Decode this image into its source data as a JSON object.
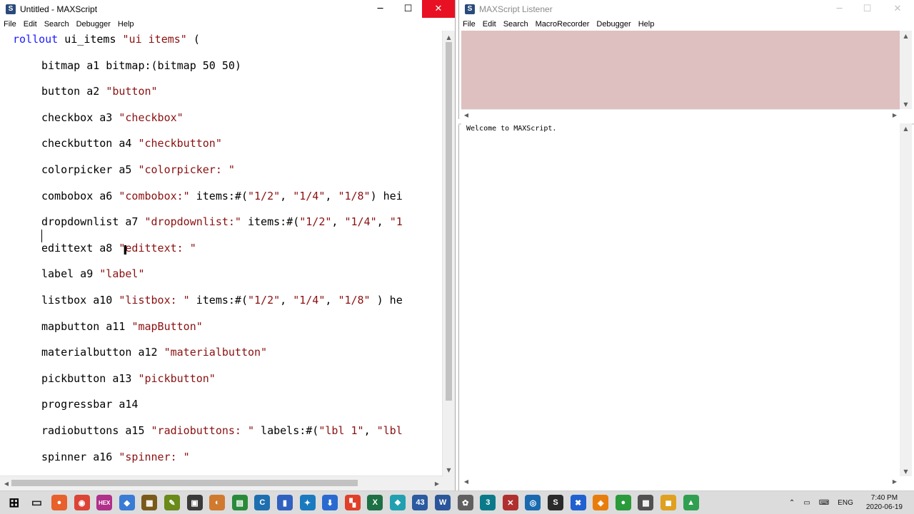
{
  "editor": {
    "title": "Untitled - MAXScript",
    "menu": [
      "File",
      "Edit",
      "Search",
      "Debugger",
      "Help"
    ],
    "code_lines": [
      {
        "indent": 0,
        "parts": [
          [
            "kw",
            "rollout"
          ],
          [
            "t",
            " ui_items "
          ],
          [
            "str",
            "\"ui items\""
          ],
          [
            "t",
            " ("
          ]
        ]
      },
      {
        "indent": 1,
        "parts": [
          [
            "t",
            "bitmap a1 bitmap:(bitmap 50 50)"
          ]
        ]
      },
      {
        "indent": 1,
        "parts": [
          [
            "t",
            "button a2 "
          ],
          [
            "str",
            "\"button\""
          ]
        ]
      },
      {
        "indent": 1,
        "parts": [
          [
            "t",
            "checkbox a3 "
          ],
          [
            "str",
            "\"checkbox\""
          ]
        ]
      },
      {
        "indent": 1,
        "parts": [
          [
            "t",
            "checkbutton a4 "
          ],
          [
            "str",
            "\"checkbutton\""
          ]
        ]
      },
      {
        "indent": 1,
        "parts": [
          [
            "t",
            "colorpicker a5 "
          ],
          [
            "str",
            "\"colorpicker: \""
          ]
        ]
      },
      {
        "indent": 1,
        "parts": [
          [
            "t",
            "combobox a6 "
          ],
          [
            "str",
            "\"combobox:\""
          ],
          [
            "t",
            " items:#("
          ],
          [
            "str",
            "\"1/2\""
          ],
          [
            "t",
            ", "
          ],
          [
            "str",
            "\"1/4\""
          ],
          [
            "t",
            ", "
          ],
          [
            "str",
            "\"1/8\""
          ],
          [
            "t",
            ") hei"
          ]
        ]
      },
      {
        "indent": 1,
        "parts": [
          [
            "t",
            "dropdownlist a7 "
          ],
          [
            "str",
            "\"dropdownlist:\""
          ],
          [
            "t",
            " items:#("
          ],
          [
            "str",
            "\"1/2\""
          ],
          [
            "t",
            ", "
          ],
          [
            "str",
            "\"1/4\""
          ],
          [
            "t",
            ", "
          ],
          [
            "str",
            "\"1"
          ]
        ]
      },
      {
        "indent": 1,
        "parts": [
          [
            "t",
            "edittext a8 "
          ],
          [
            "str",
            "\"edittext: \""
          ]
        ]
      },
      {
        "indent": 1,
        "parts": [
          [
            "t",
            "label a9 "
          ],
          [
            "str",
            "\"label\""
          ]
        ]
      },
      {
        "indent": 1,
        "parts": [
          [
            "t",
            "listbox a10 "
          ],
          [
            "str",
            "\"listbox: \""
          ],
          [
            "t",
            " items:#("
          ],
          [
            "str",
            "\"1/2\""
          ],
          [
            "t",
            ", "
          ],
          [
            "str",
            "\"1/4\""
          ],
          [
            "t",
            ", "
          ],
          [
            "str",
            "\"1/8\""
          ],
          [
            "t",
            " ) he"
          ]
        ]
      },
      {
        "indent": 1,
        "parts": [
          [
            "t",
            "mapbutton a11 "
          ],
          [
            "str",
            "\"mapButton\""
          ]
        ]
      },
      {
        "indent": 1,
        "parts": [
          [
            "t",
            "materialbutton a12 "
          ],
          [
            "str",
            "\"materialbutton\""
          ]
        ]
      },
      {
        "indent": 1,
        "parts": [
          [
            "t",
            "pickbutton a13 "
          ],
          [
            "str",
            "\"pickbutton\""
          ]
        ]
      },
      {
        "indent": 1,
        "parts": [
          [
            "t",
            "progressbar a14"
          ]
        ]
      },
      {
        "indent": 1,
        "parts": [
          [
            "t",
            "radiobuttons a15 "
          ],
          [
            "str",
            "\"radiobuttons: \""
          ],
          [
            "t",
            " labels:#("
          ],
          [
            "str",
            "\"lbl 1\""
          ],
          [
            "t",
            ", "
          ],
          [
            "str",
            "\"lbl"
          ]
        ]
      },
      {
        "indent": 1,
        "parts": [
          [
            "t",
            "spinner a16 "
          ],
          [
            "str",
            "\"spinner: \""
          ]
        ]
      }
    ]
  },
  "listener": {
    "title": "MAXScript Listener",
    "menu": [
      "File",
      "Edit",
      "Search",
      "MacroRecorder",
      "Debugger",
      "Help"
    ],
    "output": "Welcome to MAXScript."
  },
  "window_buttons": {
    "minimize": "─",
    "maximize": "☐",
    "close": "✕"
  },
  "taskbar": {
    "apps": [
      {
        "name": "start-icon",
        "label": "⊞",
        "color": "#1a1a1a"
      },
      {
        "name": "task-view-icon",
        "label": "▭",
        "color": "#555555"
      },
      {
        "name": "firefox-icon",
        "label": "●",
        "color": "#e8602c"
      },
      {
        "name": "chrome-icon",
        "label": "◉",
        "color": "#db4437"
      },
      {
        "name": "hex-icon",
        "label": "HEX",
        "color": "#b0308a"
      },
      {
        "name": "app-icon-5",
        "label": "◆",
        "color": "#3a7bd5"
      },
      {
        "name": "app-icon-6",
        "label": "▦",
        "color": "#7a5a1a"
      },
      {
        "name": "app-icon-7",
        "label": "✎",
        "color": "#6a8a1a"
      },
      {
        "name": "app-icon-8",
        "label": "▣",
        "color": "#3a3a3a"
      },
      {
        "name": "app-icon-9",
        "label": "◐",
        "color": "#d07a30"
      },
      {
        "name": "app-icon-10",
        "label": "▤",
        "color": "#2a8a3a"
      },
      {
        "name": "app-icon-11",
        "label": "C",
        "color": "#1f6fb0"
      },
      {
        "name": "app-icon-12",
        "label": "▮",
        "color": "#3060c0"
      },
      {
        "name": "app-icon-13",
        "label": "✦",
        "color": "#1a7ac0"
      },
      {
        "name": "app-icon-14",
        "label": "⬇",
        "color": "#2a6ad0"
      },
      {
        "name": "app-icon-15",
        "label": "▚",
        "color": "#e0402a"
      },
      {
        "name": "excel-icon",
        "label": "X",
        "color": "#1d7044"
      },
      {
        "name": "app-icon-17",
        "label": "❖",
        "color": "#20a0b0"
      },
      {
        "name": "mail-icon",
        "label": "43",
        "color": "#2a5aa0"
      },
      {
        "name": "word-icon",
        "label": "W",
        "color": "#2b579a"
      },
      {
        "name": "app-icon-20",
        "label": "✿",
        "color": "#606060"
      },
      {
        "name": "3dsmax-icon",
        "label": "3",
        "color": "#0a7a8a"
      },
      {
        "name": "app-icon-22",
        "label": "✕",
        "color": "#b03030"
      },
      {
        "name": "app-icon-23",
        "label": "◎",
        "color": "#1a6ab0"
      },
      {
        "name": "maxscript-icon",
        "label": "S",
        "color": "#2a2a2a"
      },
      {
        "name": "app-icon-25",
        "label": "✖",
        "color": "#2060d0"
      },
      {
        "name": "blender-icon",
        "label": "◈",
        "color": "#e87d0d"
      },
      {
        "name": "app-icon-27",
        "label": "●",
        "color": "#2a9a3a"
      },
      {
        "name": "app-icon-28",
        "label": "▦",
        "color": "#505050"
      },
      {
        "name": "app-icon-29",
        "label": "◼",
        "color": "#e0a020"
      },
      {
        "name": "app-icon-30",
        "label": "▲",
        "color": "#30a050"
      }
    ],
    "tray": [
      "⌃",
      "▭",
      "⌨",
      "ENG"
    ],
    "time": "7:40 PM",
    "date": "2020-06-19"
  }
}
